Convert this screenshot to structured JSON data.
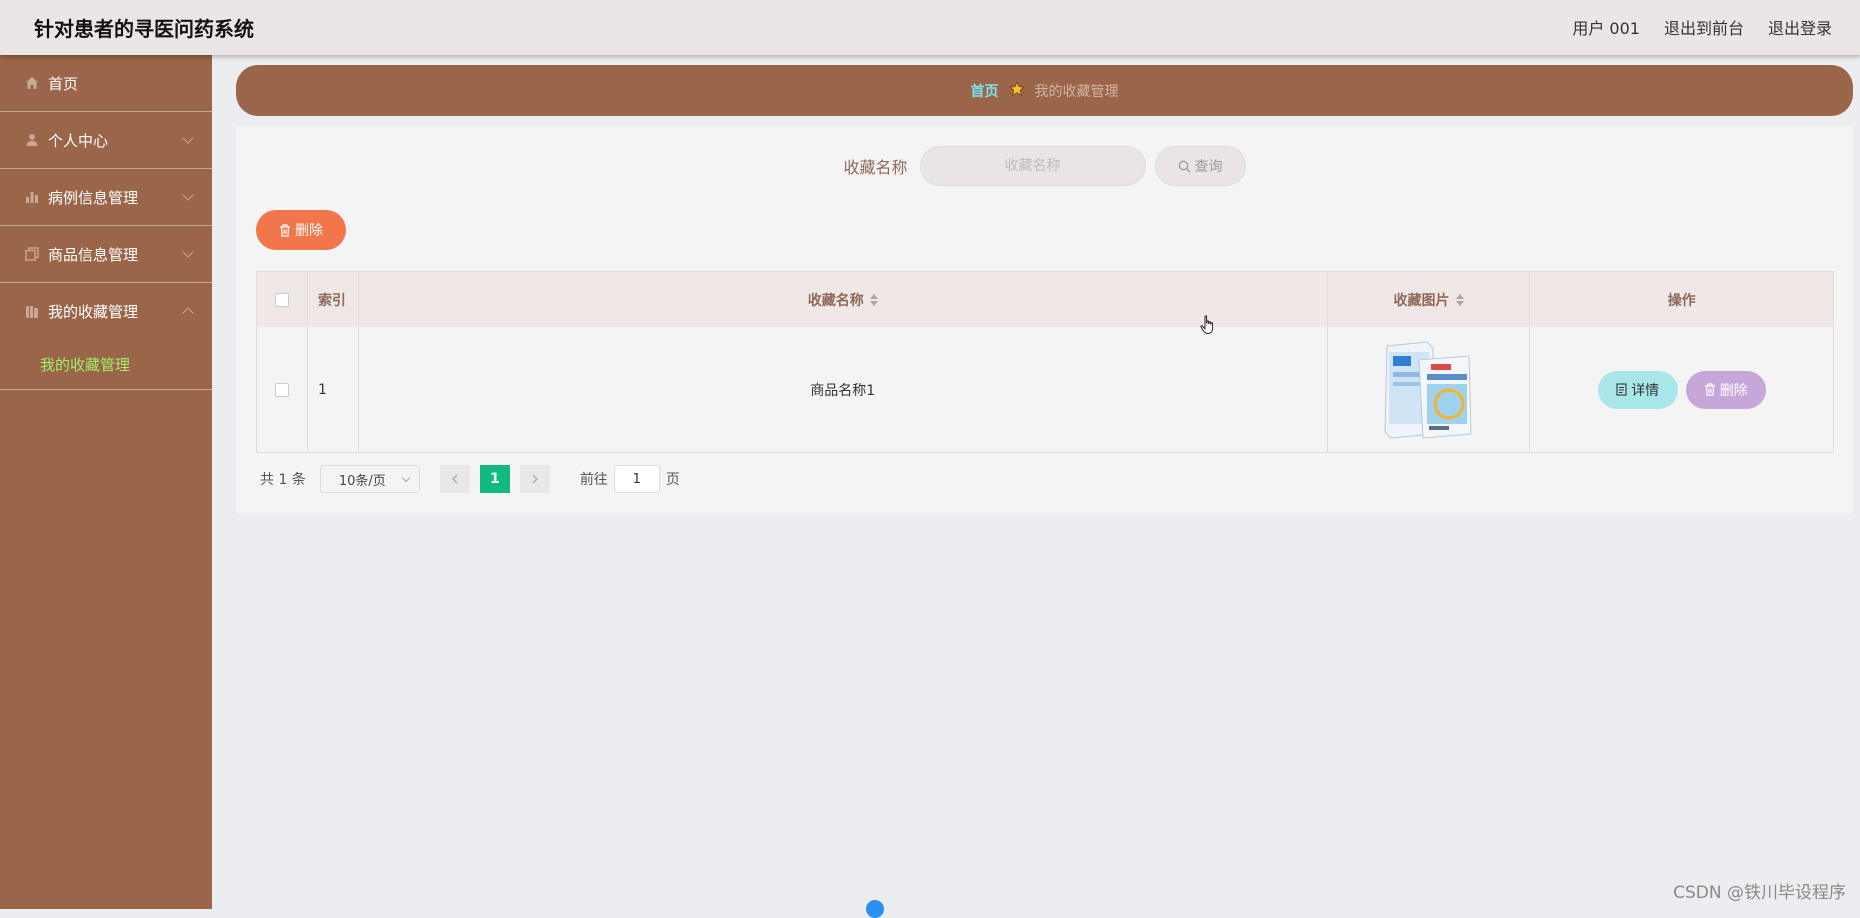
{
  "header": {
    "app_title": "针对患者的寻医问药系统",
    "user_label": "用户 001",
    "back_to_front": "退出到前台",
    "logout": "退出登录"
  },
  "sidebar": {
    "items": [
      {
        "label": "首页",
        "icon": "home-icon"
      },
      {
        "label": "个人中心",
        "icon": "user-icon"
      },
      {
        "label": "病例信息管理",
        "icon": "bar-chart-icon"
      },
      {
        "label": "商品信息管理",
        "icon": "copy-icon"
      },
      {
        "label": "我的收藏管理",
        "icon": "library-icon",
        "expanded": true
      }
    ],
    "submenu": {
      "label": "我的收藏管理"
    }
  },
  "breadcrumb": {
    "home": "首页",
    "current": "我的收藏管理"
  },
  "search": {
    "label": "收藏名称",
    "placeholder": "收藏名称",
    "value": "",
    "query_button": "查询"
  },
  "toolbar": {
    "delete_label": "删除"
  },
  "table": {
    "headers": {
      "index": "索引",
      "name": "收藏名称",
      "image": "收藏图片",
      "actions": "操作"
    },
    "rows": [
      {
        "index": "1",
        "name": "商品名称1",
        "detail_label": "详情",
        "delete_label": "删除"
      }
    ]
  },
  "pagination": {
    "total": "共 1 条",
    "page_size": "10条/页",
    "current_page": "1",
    "goto_label": "前往",
    "goto_value": "1",
    "page_suffix": "页"
  },
  "watermark": "CSDN @铁川毕设程序",
  "colors": {
    "sidebar_bg": "#9a6549",
    "delete_btn": "#f2764b",
    "detail_btn": "#a8e6ea",
    "row_delete_btn": "#c7a6d9",
    "current_page": "#12b981",
    "active_submenu": "#9ef06a",
    "breadcrumb_home": "#7de1ef"
  }
}
